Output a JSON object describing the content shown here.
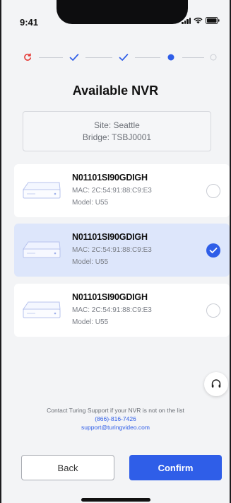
{
  "status_bar": {
    "time": "9:41"
  },
  "stepper": {
    "steps": [
      {
        "state": "error",
        "icon": "retry-icon"
      },
      {
        "state": "done",
        "icon": "check-icon"
      },
      {
        "state": "done",
        "icon": "check-icon"
      },
      {
        "state": "current",
        "icon": "dot-icon"
      },
      {
        "state": "pending",
        "icon": "empty-circle-icon"
      }
    ]
  },
  "page": {
    "title": "Available NVR",
    "site": "Site: Seattle",
    "bridge": "Bridge: TSBJ0001"
  },
  "nvr_list": [
    {
      "id": "N01101SI90GDIGH",
      "mac": "MAC: 2C:54:91:88:C9:E3",
      "model": "Model: U55",
      "selected": false
    },
    {
      "id": "N01101SI90GDIGH",
      "mac": "MAC: 2C:54:91:88:C9:E3",
      "model": "Model: U55",
      "selected": true
    },
    {
      "id": "N01101SI90GDIGH",
      "mac": "MAC: 2C:54:91:88:C9:E3",
      "model": "Model: U55",
      "selected": false
    }
  ],
  "contact": {
    "message": "Contact Turing Support if your NVR is not on the list",
    "phone": "(866)-816-7426",
    "email": "support@turingvideo.com"
  },
  "buttons": {
    "back": "Back",
    "confirm": "Confirm"
  },
  "colors": {
    "accent": "#2f5ee8",
    "error": "#e53935",
    "selected_bg": "#dde6fb"
  }
}
